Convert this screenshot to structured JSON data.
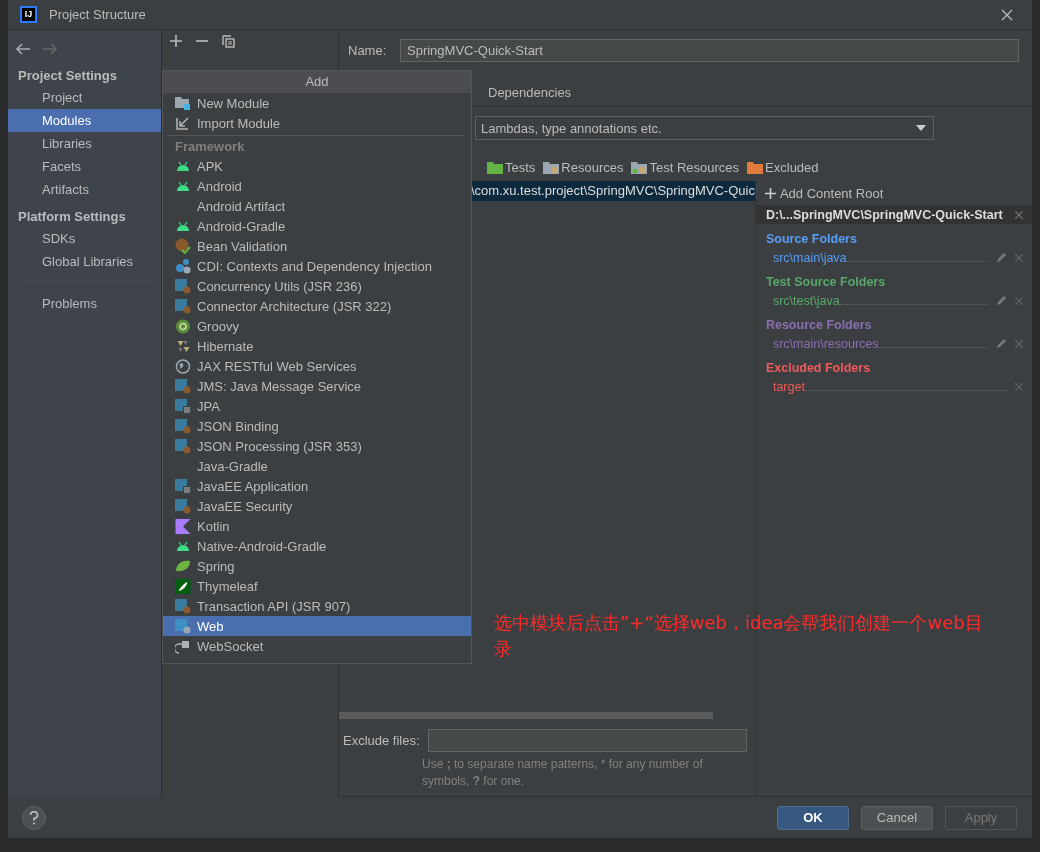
{
  "window": {
    "logo": "IJ",
    "title": "Project Structure"
  },
  "sidebar": {
    "sections": [
      {
        "title": "Project Settings",
        "items": [
          {
            "label": "Project",
            "selected": false
          },
          {
            "label": "Modules",
            "selected": true
          },
          {
            "label": "Libraries",
            "selected": false
          },
          {
            "label": "Facets",
            "selected": false
          },
          {
            "label": "Artifacts",
            "selected": false
          }
        ]
      },
      {
        "title": "Platform Settings",
        "items": [
          {
            "label": "SDKs",
            "selected": false
          },
          {
            "label": "Global Libraries",
            "selected": false
          }
        ]
      }
    ],
    "extra_items": [
      {
        "label": "Problems",
        "selected": false
      }
    ]
  },
  "module": {
    "name_label": "Name:",
    "name_value": "SpringMVC-Quick-Start",
    "tabs": [
      {
        "label": "Dependencies",
        "selected": false
      }
    ],
    "language_level": "Lambdas, type annotations etc.",
    "markers": [
      {
        "label": "Tests",
        "kind": "tests"
      },
      {
        "label": "Resources",
        "kind": "resources"
      },
      {
        "label": "Test Resources",
        "kind": "test-resources"
      },
      {
        "label": "Excluded",
        "kind": "excluded"
      }
    ],
    "content_path": "\\com.xu.test.project\\SpringMVC\\SpringMVC-Quic",
    "exclude_label": "Exclude files:",
    "exclude_hint": "Use **;** to separate name patterns, * for any number of symbols, **?** for one."
  },
  "content_roots": {
    "add_button": "Add Content Root",
    "root_path": "D:\\...SpringMVC\\SpringMVC-Quick-Start",
    "groups": [
      {
        "title": "Source Folders",
        "color": "#589df6",
        "folders": [
          {
            "path": "src\\main\\java",
            "editable": true
          }
        ]
      },
      {
        "title": "Test Source Folders",
        "color": "#59a869",
        "folders": [
          {
            "path": "src\\test\\java",
            "editable": true
          }
        ]
      },
      {
        "title": "Resource Folders",
        "color": "#8a6fb0",
        "folders": [
          {
            "path": "src\\main\\resources",
            "editable": true
          }
        ]
      },
      {
        "title": "Excluded Folders",
        "color": "#ee5b5b",
        "folders": [
          {
            "path": "target",
            "editable": false
          }
        ]
      }
    ]
  },
  "add_popup": {
    "title": "Add",
    "top_items": [
      {
        "label": "New Module",
        "kind": "module",
        "selected": false
      },
      {
        "label": "Import Module",
        "kind": "import",
        "selected": false
      }
    ],
    "section": "Framework",
    "items": [
      {
        "label": "APK",
        "kind": "android",
        "selected": false
      },
      {
        "label": "Android",
        "kind": "android",
        "selected": false
      },
      {
        "label": "Android Artifact",
        "kind": "none",
        "selected": false
      },
      {
        "label": "Android-Gradle",
        "kind": "android",
        "selected": false
      },
      {
        "label": "Bean Validation",
        "kind": "bean",
        "selected": false
      },
      {
        "label": "CDI: Contexts and Dependency Injection",
        "kind": "cdi",
        "selected": false
      },
      {
        "label": "Concurrency Utils (JSR 236)",
        "kind": "javaee",
        "selected": false
      },
      {
        "label": "Connector Architecture (JSR 322)",
        "kind": "javaee",
        "selected": false
      },
      {
        "label": "Groovy",
        "kind": "groovy",
        "selected": false
      },
      {
        "label": "Hibernate",
        "kind": "hibernate",
        "selected": false
      },
      {
        "label": "JAX RESTful Web Services",
        "kind": "globe",
        "selected": false
      },
      {
        "label": "JMS: Java Message Service",
        "kind": "javaee",
        "selected": false
      },
      {
        "label": "JPA",
        "kind": "jpa",
        "selected": false
      },
      {
        "label": "JSON Binding",
        "kind": "javaee",
        "selected": false
      },
      {
        "label": "JSON Processing (JSR 353)",
        "kind": "javaee",
        "selected": false
      },
      {
        "label": "Java-Gradle",
        "kind": "none",
        "selected": false
      },
      {
        "label": "JavaEE Application",
        "kind": "jpa",
        "selected": false
      },
      {
        "label": "JavaEE Security",
        "kind": "javaee",
        "selected": false
      },
      {
        "label": "Kotlin",
        "kind": "kotlin",
        "selected": false
      },
      {
        "label": "Native-Android-Gradle",
        "kind": "android",
        "selected": false
      },
      {
        "label": "Spring",
        "kind": "spring",
        "selected": false
      },
      {
        "label": "Thymeleaf",
        "kind": "thymeleaf",
        "selected": false
      },
      {
        "label": "Transaction API (JSR 907)",
        "kind": "javaee",
        "selected": false
      },
      {
        "label": "Web",
        "kind": "web",
        "selected": true
      },
      {
        "label": "WebSocket",
        "kind": "socket",
        "selected": false
      }
    ]
  },
  "annotation": "选中模块后点击”+“选择web，idea会帮我们创建一个web目录",
  "buttons": [
    {
      "label": "OK",
      "kind": "primary",
      "disabled": false
    },
    {
      "label": "Cancel",
      "kind": "normal",
      "disabled": false
    },
    {
      "label": "Apply",
      "kind": "normal",
      "disabled": true
    }
  ]
}
